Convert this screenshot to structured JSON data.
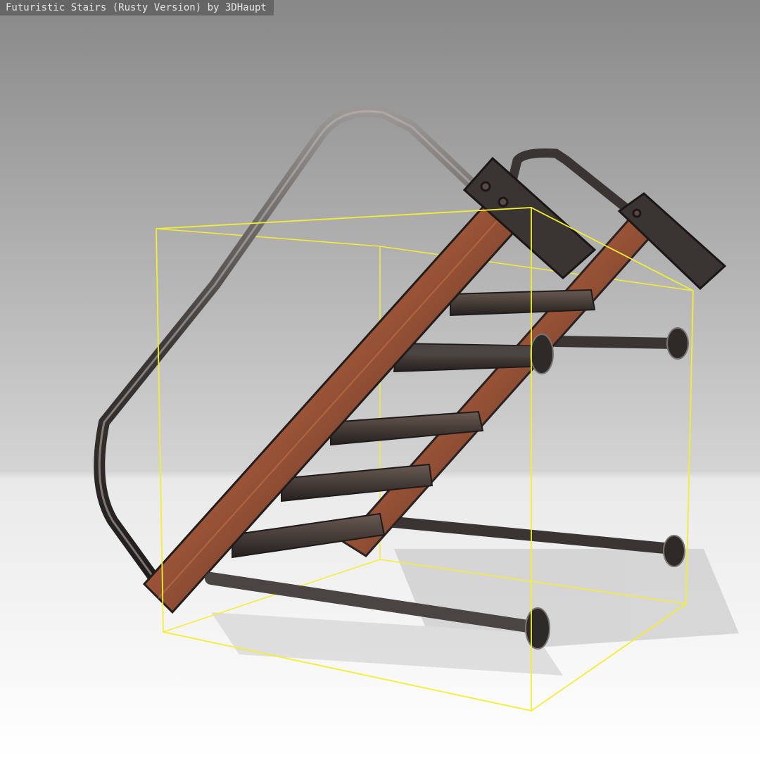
{
  "caption": "Futuristic Stairs (Rusty Version) by 3DHaupt",
  "colors": {
    "bbox_outline": "#f2ee33",
    "background_top": "#8a8a8a",
    "background_floor": "#ffffff",
    "metal": "#3a3533",
    "rust": "#a4542e"
  }
}
